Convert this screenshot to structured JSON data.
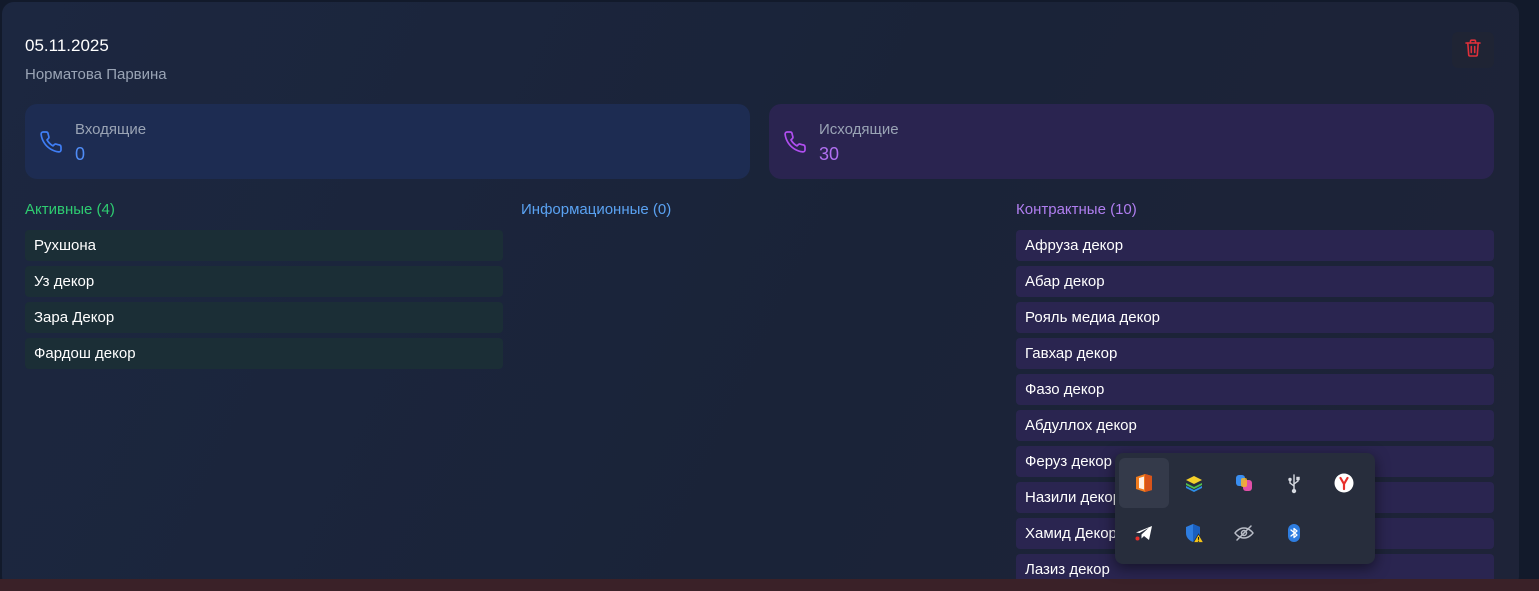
{
  "header": {
    "date": "05.11.2025",
    "person": "Норматова Парвина"
  },
  "stats": {
    "incoming": {
      "label": "Входящие",
      "value": "0",
      "icon": "phone-icon",
      "color": "#4f8cf6"
    },
    "outgoing": {
      "label": "Исходящие",
      "value": "30",
      "icon": "phone-icon",
      "color": "#b06ff0"
    }
  },
  "columns": {
    "active": {
      "title": "Активные (4)",
      "color": "#2ecc71",
      "items": [
        "Рухшона",
        "Уз декор",
        "Зара Декор",
        "Фардош декор"
      ]
    },
    "info": {
      "title": "Информационные (0)",
      "color": "#5aa2f2",
      "items": []
    },
    "contract": {
      "title": "Контрактные (10)",
      "color": "#b07ef0",
      "items": [
        "Афруза декор",
        "Абар декор",
        "Рояль медиа декор",
        "Гавхар декор",
        "Фазо декор",
        "Абдуллох декор",
        "Феруз декор",
        "Назили декор",
        "Хамид Декор",
        "Лазиз декор"
      ]
    }
  },
  "tray": {
    "icons": [
      "office-app-icon",
      "bluestacks-icon",
      "copilot-icon",
      "usb-icon",
      "yandex-browser-icon",
      "telegram-icon",
      "defender-warning-icon",
      "network-hidden-icon",
      "bluetooth-icon"
    ]
  },
  "colors": {
    "delete": "#e0303a",
    "background": "#1b2439"
  }
}
